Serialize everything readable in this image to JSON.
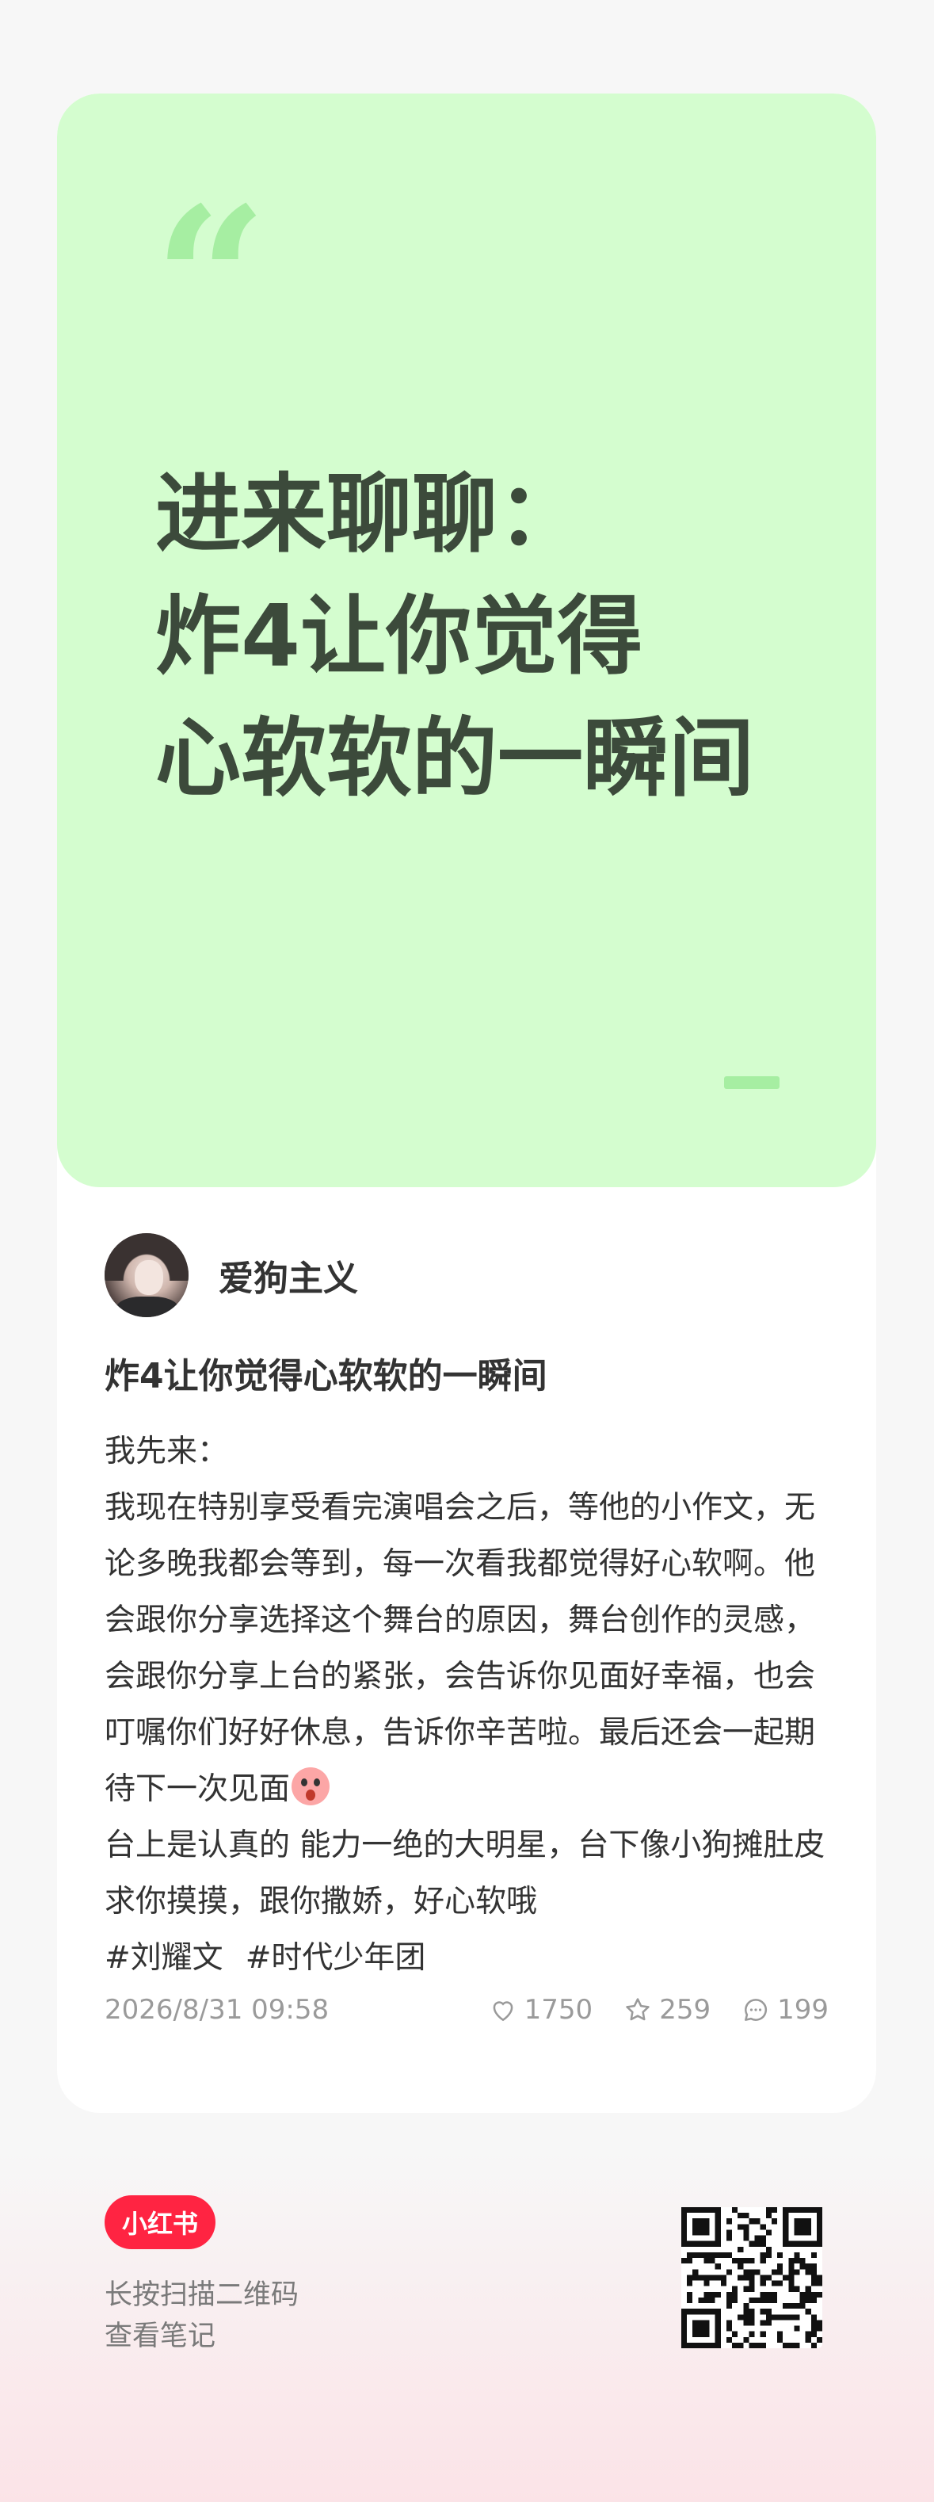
{
  "cover": {
    "quote_mark": "“",
    "title": "进来聊聊：\n炸4让你觉得\n心软软的一瞬间"
  },
  "author": {
    "name": "爱狗主义"
  },
  "note": {
    "title": "炸4让你觉得心软软的一瞬间",
    "intro": "我先来：",
    "paragraph": "我现在特别享受看完演唱会之后，等他的小作文，无论多晚我都会等到，每一次看我都觉得好心软啊。他会跟你分享选择这个舞台的原因，舞台创作的灵感，会跟你分享上台的紧张，会告诉你见面好幸福，也会叮嘱你们好好休息，告诉你辛苦啦。最后还会一起期待下一次见面",
    "paragraph2": "台上是认真的 能力一绝的大明星，台下像小狗摊肚皮求你摸摸，跟你撒娇，好心软哦",
    "tags": [
      "#刘耀文",
      "#时代少年团"
    ],
    "timestamp": "2026/8/31 09:58",
    "likes": "1750",
    "favorites": "259",
    "comments": "199"
  },
  "footer": {
    "logo": "小红书",
    "line1": "长按扫描二维码",
    "line2": "查看笔记"
  },
  "icons": {
    "like": "heart-icon",
    "favorite": "star-icon",
    "comment": "comment-icon",
    "emoji": "surprised-face-emoji"
  },
  "colors": {
    "cover_bg": "#d4fdcf",
    "cover_text": "#3c4a3b",
    "brand": "#ff2442"
  }
}
